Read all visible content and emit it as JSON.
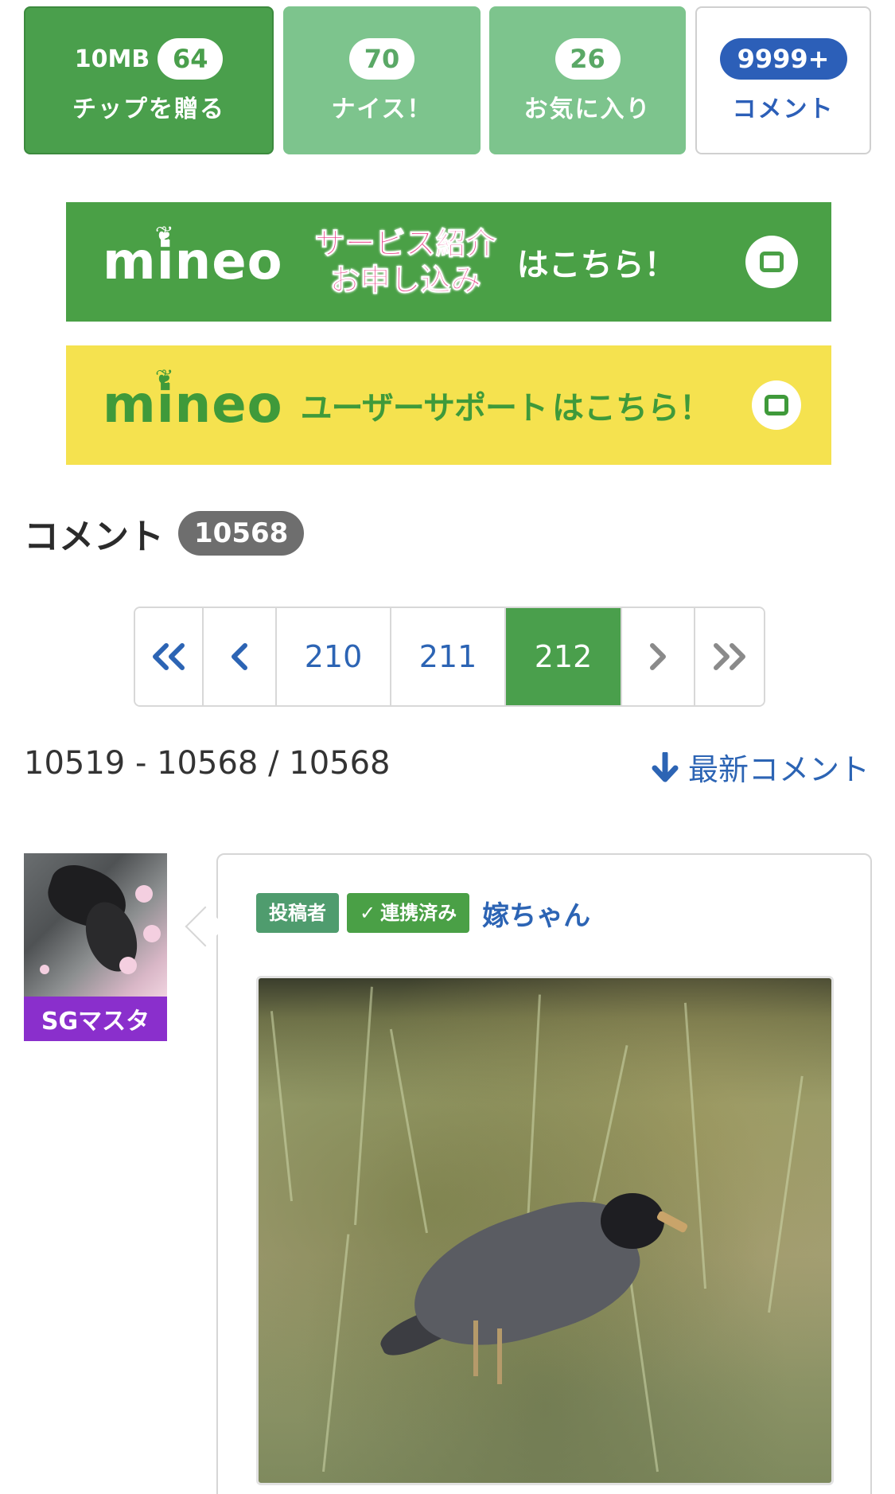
{
  "actions": {
    "tip": {
      "mb": "10MB",
      "count": "64",
      "label": "チップを贈る"
    },
    "nice": {
      "count": "70",
      "label": "ナイス！"
    },
    "favorite": {
      "count": "26",
      "label": "お気に入り"
    },
    "comment": {
      "count": "9999+",
      "label": "コメント"
    }
  },
  "banners": {
    "service": {
      "logo": "mineo",
      "line1": "サービス紹介",
      "line2": "お申し込み",
      "cta": "はこちら！"
    },
    "support": {
      "logo": "mineo",
      "text": "ユーザーサポート",
      "cta": "はこちら！"
    }
  },
  "comments": {
    "heading": "コメント",
    "count": "10568",
    "range": "10519 - 10568 / 10568",
    "latest_link": "最新コメント"
  },
  "pagination": {
    "pages": [
      "210",
      "211",
      "212"
    ],
    "current": "212"
  },
  "post": {
    "rank": "SGマスタ",
    "tag_poster": "投稿者",
    "tag_linked": "連携済み",
    "username": "嫁ちゃん"
  },
  "colors": {
    "green": "#4a9f4c",
    "light_green": "#7dc48d",
    "blue": "#2c64b4",
    "purple": "#8a2fcc",
    "yellow": "#f5e24f"
  },
  "icons": [
    "double-chevron-left-icon",
    "chevron-left-icon",
    "chevron-right-icon",
    "double-chevron-right-icon",
    "arrow-down-icon",
    "screen-icon",
    "mineo-sprout-icon"
  ]
}
